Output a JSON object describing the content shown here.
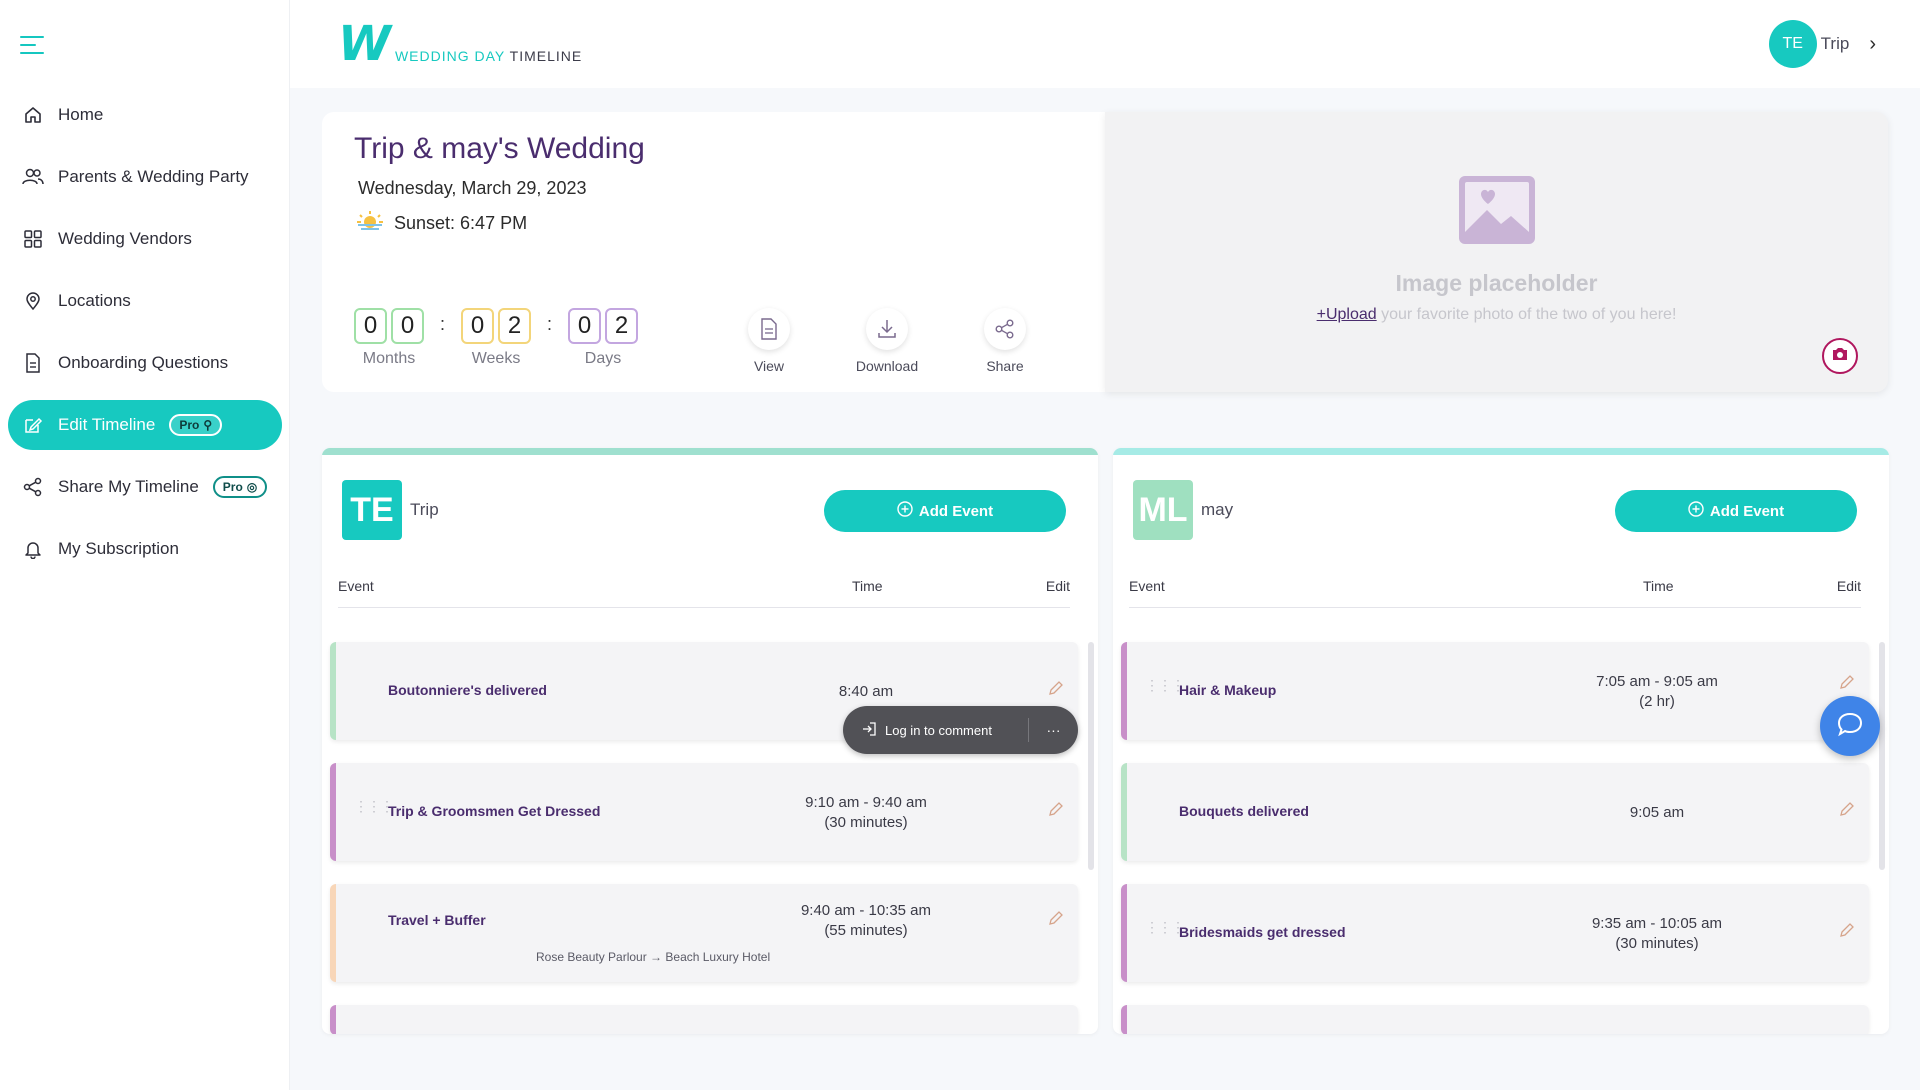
{
  "app": {
    "logo_mark": "W",
    "logo_text_1": "WEDDING DAY",
    "logo_text_2": "TIMELINE",
    "brand_color": "#17c9c0"
  },
  "user": {
    "initials": "TE",
    "name": "Trip"
  },
  "sidebar": {
    "items": [
      {
        "label": "Home",
        "icon": "home-icon"
      },
      {
        "label": "Parents & Wedding Party",
        "icon": "people-icon"
      },
      {
        "label": "Wedding Vendors",
        "icon": "grid-icon"
      },
      {
        "label": "Locations",
        "icon": "location-pin-icon"
      },
      {
        "label": "Onboarding Questions",
        "icon": "document-icon"
      },
      {
        "label": "Edit Timeline",
        "icon": "edit-icon",
        "badge": "Pro",
        "active": true
      },
      {
        "label": "Share My Timeline",
        "icon": "share-icon",
        "badge": "Pro"
      },
      {
        "label": "My Subscription",
        "icon": "bell-icon"
      }
    ]
  },
  "wedding": {
    "title": "Trip & may's Wedding",
    "date": "Wednesday, March 29, 2023",
    "sunset": "Sunset: 6:47 PM"
  },
  "countdown": {
    "months": [
      "0",
      "0"
    ],
    "weeks": [
      "0",
      "2"
    ],
    "days": [
      "0",
      "2"
    ],
    "months_label": "Months",
    "weeks_label": "Weeks",
    "days_label": "Days",
    "separator": ":"
  },
  "actions": {
    "view": "View",
    "download": "Download",
    "share": "Share"
  },
  "image_placeholder": {
    "title": "Image placeholder",
    "upload_link": "+Upload",
    "subtitle": " your favorite photo of the two of you here!"
  },
  "panels": [
    {
      "initials": "TE",
      "name": "Trip",
      "avatar_color": "#17c9c0",
      "add_label": "Add Event",
      "headers": {
        "event": "Event",
        "time": "Time",
        "edit": "Edit"
      },
      "rows": [
        {
          "event": "Boutonniere's delivered",
          "time": "8:40 am",
          "duration": "",
          "color": "#b7e3c6"
        },
        {
          "event": "Trip & Groomsmen Get Dressed",
          "time": "9:10 am - 9:40 am",
          "duration": "(30 minutes)",
          "color": "#c88fc9"
        },
        {
          "event": "Travel + Buffer",
          "time": "9:40 am - 10:35 am",
          "duration": "(55 minutes)",
          "location": "Rose Beauty Parlour → Beach Luxury Hotel",
          "color": "#f8d6b8"
        }
      ]
    },
    {
      "initials": "ML",
      "name": "may",
      "avatar_color": "#9fe0c0",
      "add_label": "Add Event",
      "headers": {
        "event": "Event",
        "time": "Time",
        "edit": "Edit"
      },
      "rows": [
        {
          "event": "Hair & Makeup",
          "time": "7:05 am - 9:05 am",
          "duration": "(2 hr)",
          "color": "#c88fc9"
        },
        {
          "event": "Bouquets delivered",
          "time": "9:05 am",
          "duration": "",
          "color": "#b7e3c6"
        },
        {
          "event": "Bridesmaids get dressed",
          "time": "9:35 am - 10:05 am",
          "duration": "(30 minutes)",
          "color": "#c88fc9"
        }
      ]
    }
  ],
  "comment_pill": {
    "label": "Log in to comment",
    "more": "···"
  }
}
